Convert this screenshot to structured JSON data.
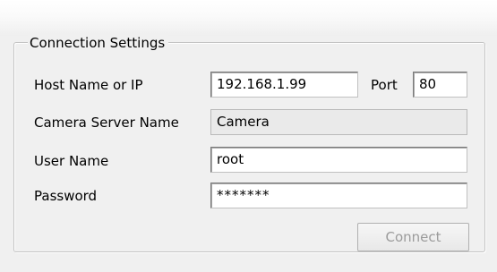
{
  "connection_settings": {
    "title": "Connection Settings",
    "host": {
      "label": "Host Name or IP",
      "value": "192.168.1.99"
    },
    "port": {
      "label": "Port",
      "value": "80"
    },
    "camera_server_name": {
      "label": "Camera Server Name",
      "value": "Camera"
    },
    "user_name": {
      "label": "User Name",
      "value": "root"
    },
    "password": {
      "label": "Password",
      "value": "*******"
    },
    "connect_button": {
      "label": "Connect",
      "enabled": false
    }
  }
}
